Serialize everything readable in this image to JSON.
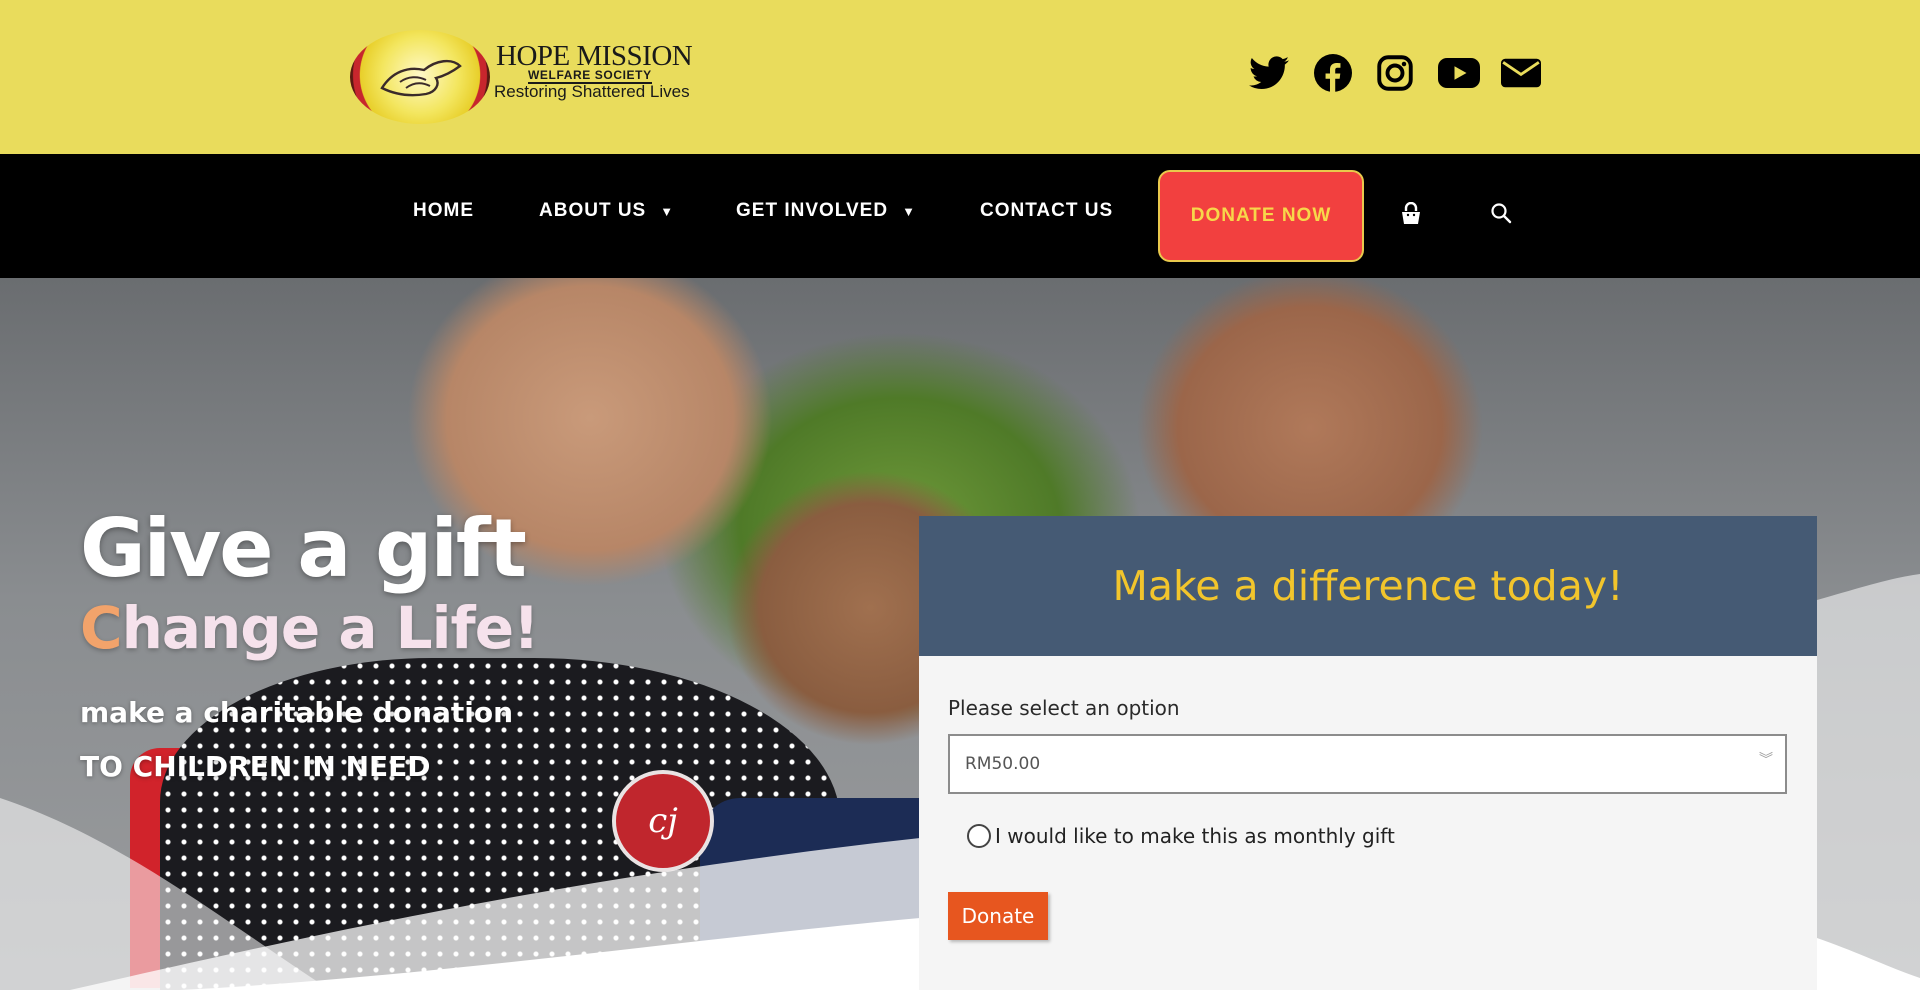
{
  "header": {
    "logo": {
      "title": "HOPE MISSION",
      "subtitle": "WELFARE SOCIETY",
      "tagline": "Restoring Shattered Lives"
    },
    "social": [
      {
        "icon": "twitter-icon"
      },
      {
        "icon": "facebook-icon"
      },
      {
        "icon": "instagram-icon"
      },
      {
        "icon": "youtube-icon"
      },
      {
        "icon": "email-icon"
      }
    ],
    "colors": {
      "background": "#e9dc5c"
    }
  },
  "nav": {
    "items": [
      {
        "label": "HOME"
      },
      {
        "label": "ABOUT US",
        "dropdown": true
      },
      {
        "label": "GET INVOLVED",
        "dropdown": true
      },
      {
        "label": "CONTACT US"
      }
    ],
    "donate_label": "DONATE NOW",
    "icons": [
      "cart-icon",
      "search-icon"
    ],
    "colors": {
      "background": "#000000",
      "donate": "#f2403f",
      "donate_text": "#f7d74a"
    }
  },
  "hero": {
    "headline": "Give a gift",
    "subheadline_first": "C",
    "subheadline_rest": "hange a Life!",
    "line1": "make a charitable donation",
    "line2": "TO CHILDREN IN NEED",
    "badge_text": "cj"
  },
  "donation_form": {
    "title": "Make a difference today!",
    "select_label": "Please select an option",
    "selected_value": "RM50.00",
    "monthly_label": "I would like to make this as monthly gift",
    "submit_label": "Donate",
    "colors": {
      "header": "#455a74",
      "title": "#f2c52c",
      "button": "#e7561f"
    }
  }
}
